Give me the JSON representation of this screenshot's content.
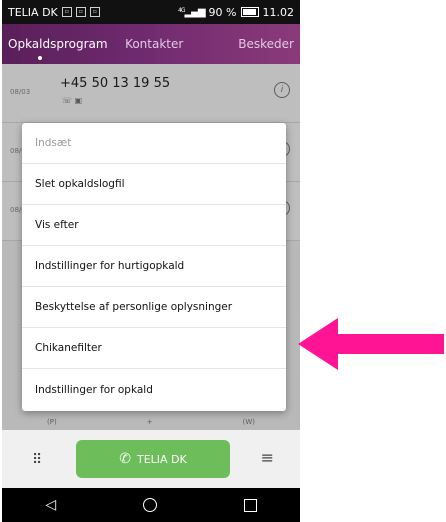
{
  "status_bar": {
    "carrier": "TELIA DK",
    "signal_badge": "4G",
    "battery_percent": "90 %",
    "time": "11.02"
  },
  "tabs": [
    {
      "label": "Opkaldsprogram",
      "active": true
    },
    {
      "label": "Kontakter",
      "active": false
    },
    {
      "label": "Beskeder",
      "active": false
    }
  ],
  "call_log": [
    {
      "date": "08/03",
      "number": "+45 50 13 19 55"
    },
    {
      "date": "08/03",
      "number": ""
    },
    {
      "date": "08/03",
      "number": ""
    }
  ],
  "menu": {
    "items": [
      {
        "label": "Indsæt",
        "disabled": true
      },
      {
        "label": "Slet opkaldslogfil",
        "disabled": false
      },
      {
        "label": "Vis efter",
        "disabled": false
      },
      {
        "label": "Indstillinger for hurtigopkald",
        "disabled": false
      },
      {
        "label": "Beskyttelse af personlige oplysninger",
        "disabled": false
      },
      {
        "label": "Chikanefilter",
        "disabled": false
      },
      {
        "label": "Indstillinger for opkald",
        "disabled": false
      }
    ]
  },
  "dialpad_hints": [
    "(P)",
    "+",
    "(W)"
  ],
  "call_button": {
    "label": "TELIA DK"
  },
  "colors": {
    "accent": "#6e2a6e",
    "call_green": "#6dbd5a",
    "arrow": "#ff1493"
  }
}
